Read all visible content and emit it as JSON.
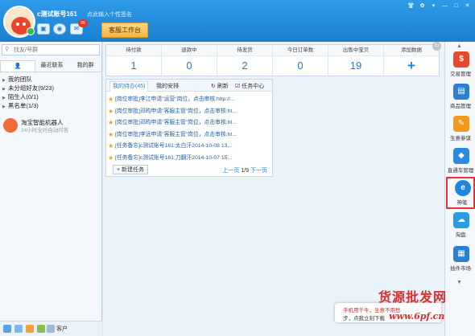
{
  "header": {
    "username": "c测试账号161",
    "signature": "点此输入个性签名",
    "mail_badge": "99",
    "service_button": "客服工作台",
    "window_buttons": [
      "👕",
      "✿",
      "▾",
      "—",
      "□",
      "✕"
    ]
  },
  "left": {
    "search_placeholder": "找友/号群",
    "tabs": [
      "",
      "最近联系",
      "我的群"
    ],
    "groups": [
      "我的团队",
      "未分组好友(9/23)",
      "陌生人(0/1)",
      "黑名单(1/3)"
    ],
    "robot": {
      "name": "淘宝智能机器人",
      "desc": "24小时全时自动问答"
    },
    "bottom_label": "客户"
  },
  "stats": [
    {
      "label": "待付款",
      "value": "1"
    },
    {
      "label": "退款中",
      "value": "0"
    },
    {
      "label": "待发货",
      "value": "2"
    },
    {
      "label": "今日订单数",
      "value": "0"
    },
    {
      "label": "出售中宝贝",
      "value": "19"
    },
    {
      "label": "添加数据",
      "value": "+"
    }
  ],
  "tasks": {
    "tab_mine": "我的待办(45)",
    "tab_assigned": "我的安排",
    "refresh": "刷新",
    "center": "任务中心",
    "items": [
      "[岗位审批]李江申请\"运营\"岗位，点击审核:http://...",
      "[岗位审批]邓昀申请\"客服主管\"岗位，点击审核:ht...",
      "[岗位审批]邓昀申请\"客服主管\"岗位，点击审核:ht...",
      "[岗位审批]李远申请\"客服主管\"岗位，点击审核:ht...",
      "[任务备忘]c测试账号161:太白汗2014-10-08 13...",
      "[任务备忘]c测试账号161:刀翻汗2014-10-07 15..."
    ],
    "new_task": "+ 新建任务",
    "prev": "上一页",
    "page": "1/9",
    "next": "下一页"
  },
  "right_apps": [
    {
      "label": "交易管理",
      "color": "#e64a2e",
      "glyph": "$"
    },
    {
      "label": "商品管理",
      "color": "#2f7fd0",
      "glyph": "▤"
    },
    {
      "label": "生意参谋",
      "color": "#f29a1a",
      "glyph": "✎"
    },
    {
      "label": "直通车管理",
      "color": "#2a8ae0",
      "glyph": "◆"
    },
    {
      "label": "神笔",
      "color": "#1d88db",
      "glyph": "e"
    },
    {
      "label": "淘盘",
      "color": "#2a9de0",
      "glyph": "☁"
    },
    {
      "label": "插件市场",
      "color": "#2a7fd0",
      "glyph": "▦"
    }
  ],
  "notify": {
    "line1": "手机用千牛，生意不用愁",
    "line2": "步，点我立刻下载"
  },
  "watermark": "货源批发网",
  "watermark2": "www.6pf.cn"
}
